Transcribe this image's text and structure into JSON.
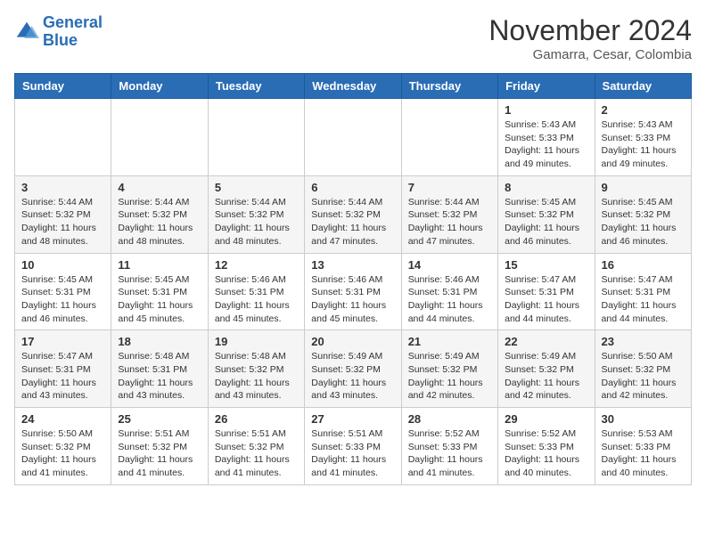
{
  "header": {
    "logo_line1": "General",
    "logo_line2": "Blue",
    "month": "November 2024",
    "location": "Gamarra, Cesar, Colombia"
  },
  "weekdays": [
    "Sunday",
    "Monday",
    "Tuesday",
    "Wednesday",
    "Thursday",
    "Friday",
    "Saturday"
  ],
  "weeks": [
    [
      {
        "day": "",
        "info": ""
      },
      {
        "day": "",
        "info": ""
      },
      {
        "day": "",
        "info": ""
      },
      {
        "day": "",
        "info": ""
      },
      {
        "day": "",
        "info": ""
      },
      {
        "day": "1",
        "info": "Sunrise: 5:43 AM\nSunset: 5:33 PM\nDaylight: 11 hours\nand 49 minutes."
      },
      {
        "day": "2",
        "info": "Sunrise: 5:43 AM\nSunset: 5:33 PM\nDaylight: 11 hours\nand 49 minutes."
      }
    ],
    [
      {
        "day": "3",
        "info": "Sunrise: 5:44 AM\nSunset: 5:32 PM\nDaylight: 11 hours\nand 48 minutes."
      },
      {
        "day": "4",
        "info": "Sunrise: 5:44 AM\nSunset: 5:32 PM\nDaylight: 11 hours\nand 48 minutes."
      },
      {
        "day": "5",
        "info": "Sunrise: 5:44 AM\nSunset: 5:32 PM\nDaylight: 11 hours\nand 48 minutes."
      },
      {
        "day": "6",
        "info": "Sunrise: 5:44 AM\nSunset: 5:32 PM\nDaylight: 11 hours\nand 47 minutes."
      },
      {
        "day": "7",
        "info": "Sunrise: 5:44 AM\nSunset: 5:32 PM\nDaylight: 11 hours\nand 47 minutes."
      },
      {
        "day": "8",
        "info": "Sunrise: 5:45 AM\nSunset: 5:32 PM\nDaylight: 11 hours\nand 46 minutes."
      },
      {
        "day": "9",
        "info": "Sunrise: 5:45 AM\nSunset: 5:32 PM\nDaylight: 11 hours\nand 46 minutes."
      }
    ],
    [
      {
        "day": "10",
        "info": "Sunrise: 5:45 AM\nSunset: 5:31 PM\nDaylight: 11 hours\nand 46 minutes."
      },
      {
        "day": "11",
        "info": "Sunrise: 5:45 AM\nSunset: 5:31 PM\nDaylight: 11 hours\nand 45 minutes."
      },
      {
        "day": "12",
        "info": "Sunrise: 5:46 AM\nSunset: 5:31 PM\nDaylight: 11 hours\nand 45 minutes."
      },
      {
        "day": "13",
        "info": "Sunrise: 5:46 AM\nSunset: 5:31 PM\nDaylight: 11 hours\nand 45 minutes."
      },
      {
        "day": "14",
        "info": "Sunrise: 5:46 AM\nSunset: 5:31 PM\nDaylight: 11 hours\nand 44 minutes."
      },
      {
        "day": "15",
        "info": "Sunrise: 5:47 AM\nSunset: 5:31 PM\nDaylight: 11 hours\nand 44 minutes."
      },
      {
        "day": "16",
        "info": "Sunrise: 5:47 AM\nSunset: 5:31 PM\nDaylight: 11 hours\nand 44 minutes."
      }
    ],
    [
      {
        "day": "17",
        "info": "Sunrise: 5:47 AM\nSunset: 5:31 PM\nDaylight: 11 hours\nand 43 minutes."
      },
      {
        "day": "18",
        "info": "Sunrise: 5:48 AM\nSunset: 5:31 PM\nDaylight: 11 hours\nand 43 minutes."
      },
      {
        "day": "19",
        "info": "Sunrise: 5:48 AM\nSunset: 5:32 PM\nDaylight: 11 hours\nand 43 minutes."
      },
      {
        "day": "20",
        "info": "Sunrise: 5:49 AM\nSunset: 5:32 PM\nDaylight: 11 hours\nand 43 minutes."
      },
      {
        "day": "21",
        "info": "Sunrise: 5:49 AM\nSunset: 5:32 PM\nDaylight: 11 hours\nand 42 minutes."
      },
      {
        "day": "22",
        "info": "Sunrise: 5:49 AM\nSunset: 5:32 PM\nDaylight: 11 hours\nand 42 minutes."
      },
      {
        "day": "23",
        "info": "Sunrise: 5:50 AM\nSunset: 5:32 PM\nDaylight: 11 hours\nand 42 minutes."
      }
    ],
    [
      {
        "day": "24",
        "info": "Sunrise: 5:50 AM\nSunset: 5:32 PM\nDaylight: 11 hours\nand 41 minutes."
      },
      {
        "day": "25",
        "info": "Sunrise: 5:51 AM\nSunset: 5:32 PM\nDaylight: 11 hours\nand 41 minutes."
      },
      {
        "day": "26",
        "info": "Sunrise: 5:51 AM\nSunset: 5:32 PM\nDaylight: 11 hours\nand 41 minutes."
      },
      {
        "day": "27",
        "info": "Sunrise: 5:51 AM\nSunset: 5:33 PM\nDaylight: 11 hours\nand 41 minutes."
      },
      {
        "day": "28",
        "info": "Sunrise: 5:52 AM\nSunset: 5:33 PM\nDaylight: 11 hours\nand 41 minutes."
      },
      {
        "day": "29",
        "info": "Sunrise: 5:52 AM\nSunset: 5:33 PM\nDaylight: 11 hours\nand 40 minutes."
      },
      {
        "day": "30",
        "info": "Sunrise: 5:53 AM\nSunset: 5:33 PM\nDaylight: 11 hours\nand 40 minutes."
      }
    ]
  ]
}
